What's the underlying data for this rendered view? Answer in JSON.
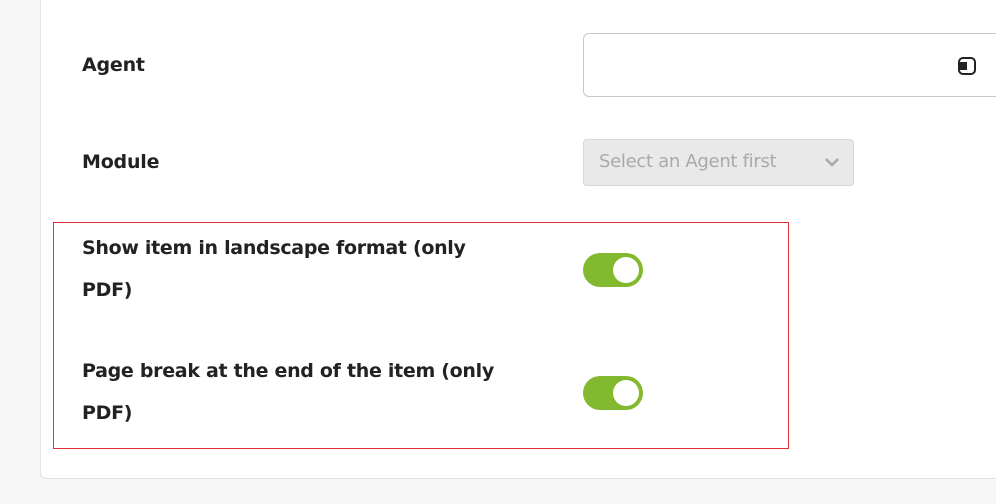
{
  "form": {
    "agent": {
      "label": "Agent",
      "value": "",
      "icon": "agent-picker-icon"
    },
    "module": {
      "label": "Module",
      "placeholder": "Select an Agent first",
      "disabled": true
    },
    "landscape": {
      "label_line1": "Show item in landscape format (only",
      "label_line2": "PDF)",
      "enabled": true
    },
    "page_break": {
      "label_line1": "Page break at the end of the item (only",
      "label_line2": "PDF)",
      "enabled": true
    }
  },
  "colors": {
    "toggle_on": "#82b92e",
    "highlight": "#e0303a",
    "disabled_bg": "#e9e9e9"
  }
}
